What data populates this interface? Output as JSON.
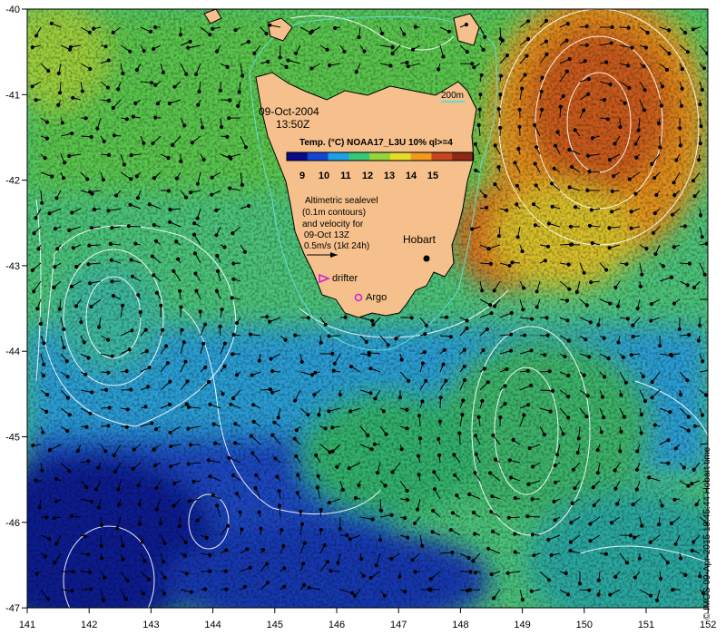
{
  "map": {
    "date": "09-Oct-2004",
    "time": "13:50Z",
    "colorbar": {
      "title": "Temp. (°C) NOAA17_L3U 10% ql>=4",
      "ticks": [
        "9",
        "10",
        "11",
        "12",
        "13",
        "14",
        "15"
      ],
      "colors": [
        "#0a0a8c",
        "#1346d8",
        "#1ea0e6",
        "#36c878",
        "#96d23c",
        "#e6dc28",
        "#f09a1e",
        "#c8461e",
        "#8c2814"
      ]
    },
    "isobath_label": "200m",
    "legend_text": [
      "Altimetric sealevel",
      "(0.1m contours)",
      "and velocity for",
      "09-Oct 13Z",
      "0.5m/s (1kt 24h)"
    ],
    "markers": {
      "hobart": "Hobart",
      "drifter": "drifter",
      "argo": "Argo"
    },
    "axes": {
      "x_ticks": [
        "141",
        "142",
        "143",
        "144",
        "145",
        "146",
        "147",
        "148",
        "149",
        "150",
        "151",
        "152"
      ],
      "y_ticks": [
        "-40",
        "-41",
        "-42",
        "-43",
        "-44",
        "-45",
        "-46",
        "-47"
      ]
    },
    "credit": "© IMOS 09-Apr-2015 18:45:44 Hobart time",
    "colors": {
      "land": "#f5c08c",
      "contour": "#ffffff",
      "isobath": "#64dcd2",
      "marker": "#d21ed2"
    }
  }
}
